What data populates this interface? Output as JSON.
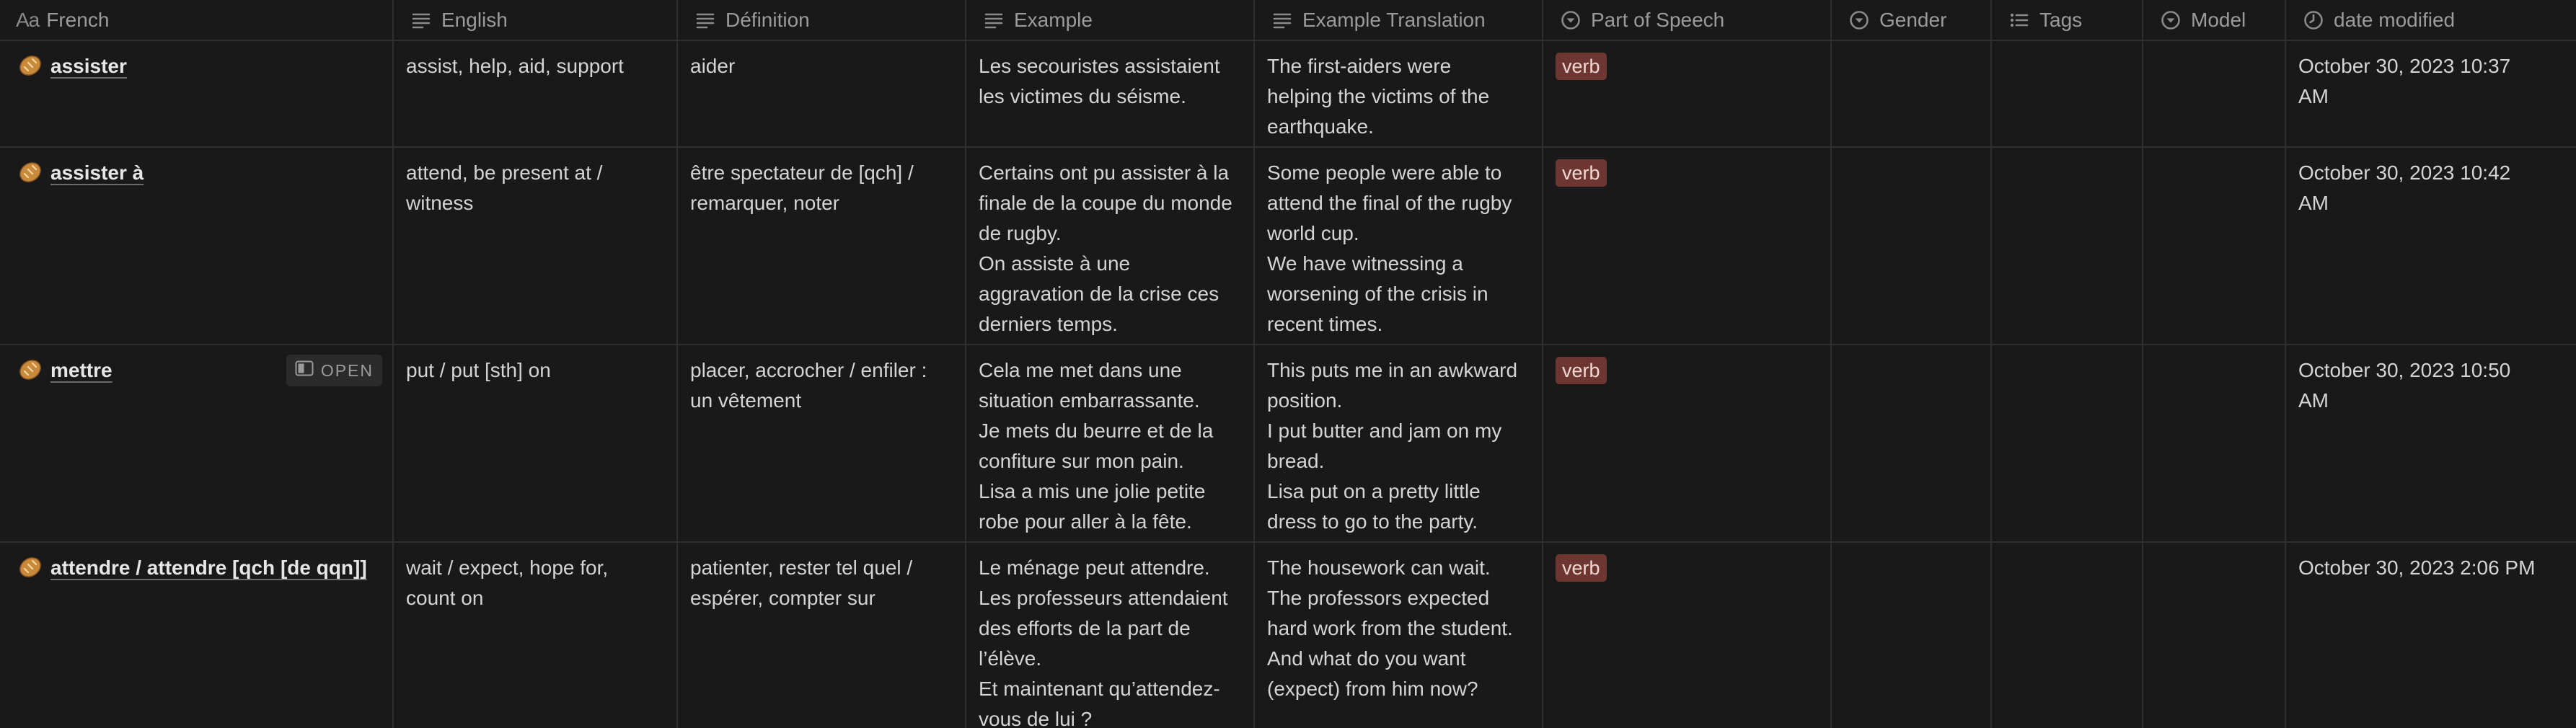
{
  "columns": [
    {
      "label": "French",
      "icon": "aa-title-icon"
    },
    {
      "label": "English",
      "icon": "text-lines-icon"
    },
    {
      "label": "Définition",
      "icon": "text-lines-icon"
    },
    {
      "label": "Example",
      "icon": "text-lines-icon"
    },
    {
      "label": "Example Translation",
      "icon": "text-lines-icon"
    },
    {
      "label": "Part of Speech",
      "icon": "select-chevron-icon"
    },
    {
      "label": "Gender",
      "icon": "select-chevron-icon"
    },
    {
      "label": "Tags",
      "icon": "list-icon"
    },
    {
      "label": "Model",
      "icon": "select-chevron-icon"
    },
    {
      "label": "date modified",
      "icon": "clock-icon"
    }
  ],
  "icon_glyphs": {
    "title_aa": "Aa"
  },
  "open_label": "OPEN",
  "colors": {
    "background": "#191919",
    "grid_line": "#2f2f2f",
    "verb_tag_bg": "#6e3630",
    "verb_tag_text": "#f0d8d4",
    "header_text": "#9b9b9b"
  },
  "rows": [
    {
      "french": "assister",
      "english": [
        "assist, help, aid, support"
      ],
      "definition": [
        "aider"
      ],
      "example": [
        "Les secouristes assistaient",
        "les victimes du séisme."
      ],
      "translation": [
        "The first-aiders were",
        "helping the victims of the",
        "earthquake."
      ],
      "pos": "verb",
      "date": [
        "October 30, 2023 10:37",
        "AM"
      ]
    },
    {
      "french": "assister à",
      "english": [
        "attend, be present at /",
        "witness"
      ],
      "definition": [
        "être spectateur de [qch] /",
        "remarquer, noter"
      ],
      "example": [
        "Certains ont pu assister à la",
        "finale de la coupe du monde",
        "de rugby.",
        "On assiste à une",
        "aggravation de la crise ces",
        "derniers temps."
      ],
      "translation": [
        "Some people were able to",
        "attend the final of the rugby",
        "world cup.",
        "We have witnessing a",
        "worsening of the crisis in",
        "recent times."
      ],
      "pos": "verb",
      "date": [
        "October 30, 2023 10:42",
        "AM"
      ]
    },
    {
      "french": "mettre",
      "english": [
        "put / put [sth] on"
      ],
      "definition": [
        "placer, accrocher / enfiler :",
        "un vêtement"
      ],
      "example": [
        "Cela me met dans une",
        "situation embarrassante.",
        "Je mets du beurre et de la",
        "confiture sur mon pain.",
        "Lisa a mis une jolie petite",
        "robe pour aller à la fête."
      ],
      "translation": [
        "This puts me in an awkward",
        "position.",
        "I put butter and jam on my",
        "bread.",
        "Lisa put on a pretty little",
        "dress to go to the party."
      ],
      "pos": "verb",
      "date": [
        "October 30, 2023 10:50",
        "AM"
      ]
    },
    {
      "french": "attendre / attendre [qch [de qqn]]",
      "english": [
        "wait / expect, hope for,",
        "count on"
      ],
      "definition": [
        "patienter, rester tel quel /",
        "espérer, compter sur"
      ],
      "example": [
        "Le ménage peut attendre.",
        "Les professeurs attendaient",
        "des efforts de la part de",
        "l’élève.",
        "Et maintenant qu’attendez-",
        "vous de lui ?"
      ],
      "translation": [
        "The housework can wait.",
        "The professors expected",
        "hard work from the student.",
        "And what do you want",
        "(expect) from him now?"
      ],
      "pos": "verb",
      "date": [
        "October 30, 2023 2:06 PM"
      ]
    }
  ]
}
